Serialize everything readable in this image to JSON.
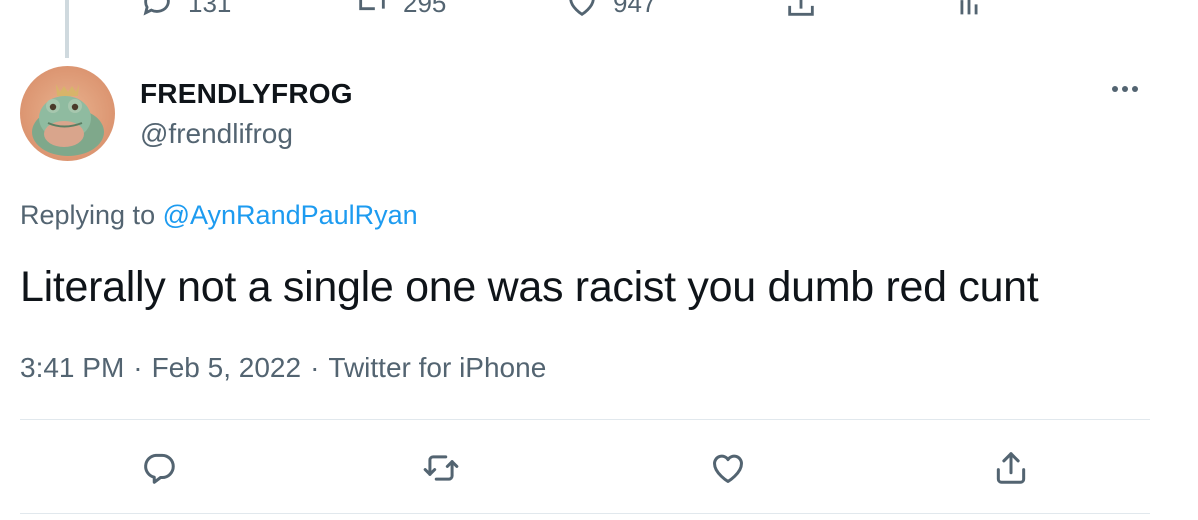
{
  "previous_tweet": {
    "reply_count": "131",
    "retweet_count": "295",
    "like_count": "947"
  },
  "tweet": {
    "display_name": "FRENDLYFROG",
    "handle": "@frendlifrog",
    "replying_to_prefix": "Replying to",
    "replying_to_handle": "@AynRandPaulRyan",
    "text": "Literally not a single one was racist you dumb red cunt",
    "time": "3:41 PM",
    "date": "Feb 5, 2022",
    "source": "Twitter for iPhone",
    "separator": "·"
  },
  "icons": {
    "reply": "reply-icon",
    "retweet": "retweet-icon",
    "like": "heart-icon",
    "share": "share-icon",
    "analytics": "analytics-icon",
    "more": "more-icon"
  },
  "colors": {
    "accent": "#1d9bf0",
    "secondary_text": "#536471",
    "primary_text": "#0f1419",
    "divider": "#e1e8ed"
  }
}
